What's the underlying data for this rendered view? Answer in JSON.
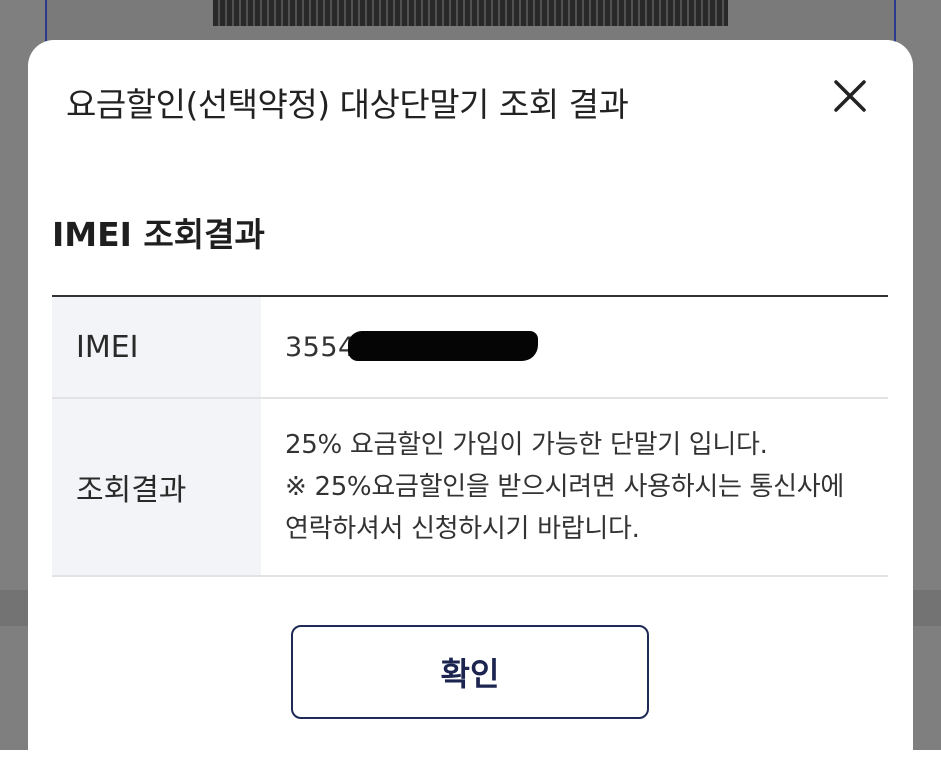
{
  "modal": {
    "title": "요금할인(선택약정) 대상단말기 조회 결과",
    "close_icon": "close-icon"
  },
  "section": {
    "title": "IMEI 조회결과"
  },
  "table": {
    "rows": [
      {
        "label": "IMEI",
        "value": "35540"
      },
      {
        "label": "조회결과",
        "lines": [
          "25% 요금할인 가입이 가능한 단말기 입니다.",
          "※ 25%요금할인을 받으시려면 사용하시는 통신사에",
          "연락하셔서 신청하시기 바랍니다."
        ]
      }
    ]
  },
  "footer": {
    "confirm_label": "확인"
  },
  "colors": {
    "overlay": "#7f7f7f",
    "modal_bg": "#ffffff",
    "header_cell_bg": "#f3f4f7",
    "button_border": "#1e2a55",
    "bg_panel_border": "#2b3a8a"
  }
}
